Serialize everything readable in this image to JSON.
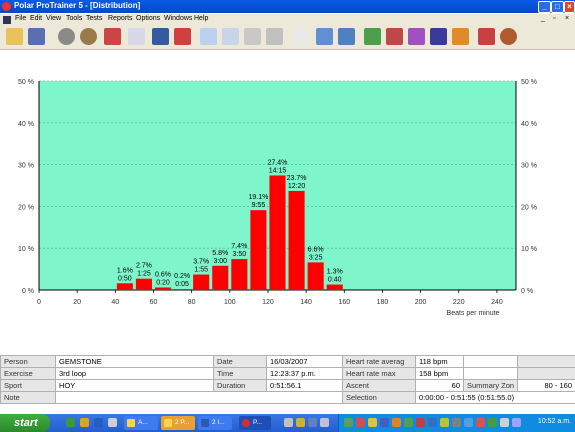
{
  "window": {
    "title": "Polar ProTrainer 5 - [Distribution]",
    "min": "_",
    "max": "□",
    "close": "×"
  },
  "menu": [
    "File",
    "Edit",
    "View",
    "Tools",
    "Tests",
    "Reports",
    "Options",
    "Windows",
    "Help"
  ],
  "chart_data": {
    "type": "bar",
    "xlabel": "Beats per minute",
    "x_ticks": [
      0,
      20,
      40,
      60,
      80,
      100,
      120,
      140,
      160,
      180,
      200,
      220,
      240
    ],
    "y_ticks": [
      "0 %",
      "10 %",
      "20 %",
      "30 %",
      "40 %",
      "50 %"
    ],
    "ylim": [
      0,
      50
    ],
    "xlim": [
      0,
      250
    ],
    "grid": true,
    "bin_width": 10,
    "bar_color": "#ff0000",
    "plot_bg": "#7ff5cc",
    "bins": [
      {
        "x": 45,
        "pct": 1.6,
        "label_pct": "1.6%",
        "label_time": "0:50"
      },
      {
        "x": 55,
        "pct": 2.7,
        "label_pct": "2.7%",
        "label_time": "1:25"
      },
      {
        "x": 65,
        "pct": 0.6,
        "label_pct": "0.6%",
        "label_time": "0:20"
      },
      {
        "x": 75,
        "pct": 0.2,
        "label_pct": "0.2%",
        "label_time": "0:05"
      },
      {
        "x": 85,
        "pct": 3.7,
        "label_pct": "3.7%",
        "label_time": "1:55"
      },
      {
        "x": 95,
        "pct": 5.8,
        "label_pct": "5.8%",
        "label_time": "3:00"
      },
      {
        "x": 105,
        "pct": 7.4,
        "label_pct": "7.4%",
        "label_time": "3:50"
      },
      {
        "x": 115,
        "pct": 19.1,
        "label_pct": "19.1%",
        "label_time": "9:55"
      },
      {
        "x": 125,
        "pct": 27.4,
        "label_pct": "27.4%",
        "label_time": "14:15"
      },
      {
        "x": 135,
        "pct": 23.7,
        "label_pct": "23.7%",
        "label_time": "12:20"
      },
      {
        "x": 145,
        "pct": 6.6,
        "label_pct": "6.6%",
        "label_time": "3:25"
      },
      {
        "x": 155,
        "pct": 1.3,
        "label_pct": "1.3%",
        "label_time": "0:40"
      }
    ]
  },
  "info": {
    "person_label": "Person",
    "person": "GEMSTONE",
    "exercise_label": "Exercise",
    "exercise": "3rd loop",
    "sport_label": "Sport",
    "sport": "HOY",
    "note_label": "Note",
    "date_label": "Date",
    "date": "16/03/2007",
    "time_label": "Time",
    "time": "12:23:37 p.m.",
    "duration_label": "Duration",
    "duration": "0:51:56.1",
    "hr_avg_label": "Heart rate averag",
    "hr_avg": "118 bpm",
    "hr_max_label": "Heart rate max",
    "hr_max": "158 bpm",
    "ascent_label": "Ascent",
    "ascent": "60",
    "summary_label": "Summary Zon",
    "summary": "80 - 160",
    "selection_label": "Selection",
    "selection": "0:00:00 - 0:51:55 (0:51:55.0)"
  },
  "taskbar": {
    "start": "start",
    "tasks": [
      "A...",
      "2 P...",
      "2 I...",
      "P..."
    ],
    "clock": "10:52 a.m."
  }
}
